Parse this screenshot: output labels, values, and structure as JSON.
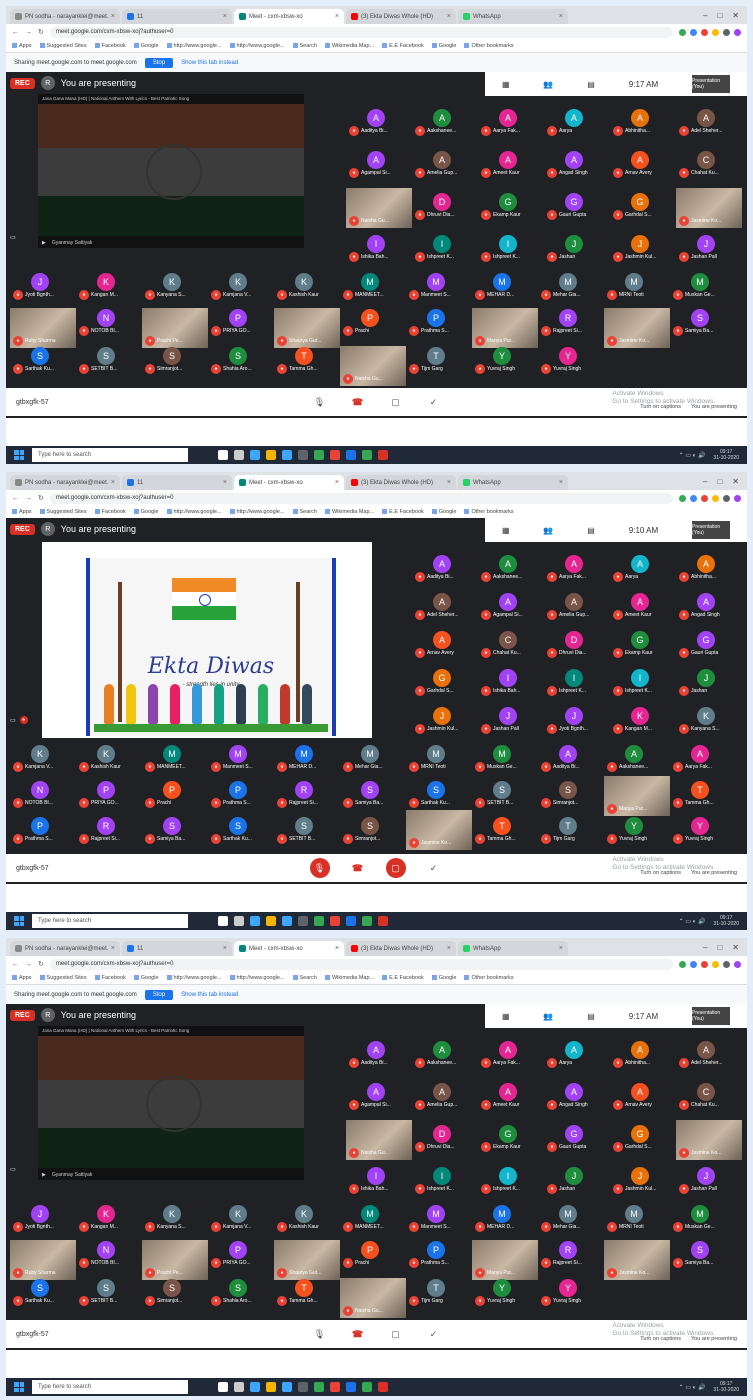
{
  "browser": {
    "tabs": [
      {
        "label": "PN sodha - narayanklei@meet.",
        "color": "#888888",
        "active": false
      },
      {
        "label": "11",
        "color": "#1a73e8",
        "active": false
      },
      {
        "label": "Meet - cxm-xbsw-xo",
        "color": "#00897b",
        "active": true
      },
      {
        "label": "(3) Ekta Diwas Whole (HD)",
        "color": "#ff0000",
        "active": false
      },
      {
        "label": "WhatsApp",
        "color": "#25d366",
        "active": false
      }
    ],
    "url": "meet.google.com/cxm-xbsw-xoj?authuser=0",
    "bookmarks": [
      "Apps",
      "Suggested Sites",
      "Facebook",
      "Google",
      "http://www.google...",
      "http://www.google...",
      "Search",
      "Wikimedia Map...",
      "E.E Facebook",
      "Google",
      "Other bookmarks"
    ],
    "infobar_text": "Sharing meet.google.com to meet.google.com",
    "infobar_button": "Stop",
    "infobar_link": "Show this tab instead"
  },
  "meeting": {
    "rec": "REC",
    "presenting_initial": "R",
    "presenting_label": "You are presenting",
    "panel_time_1": "9:17 AM",
    "panel_time_2": "9:10 AM",
    "panel_pres": "Presentation (You)",
    "meeting_code": "gtbxgfk-57",
    "video_title": "Jana Gana Mana (HD) | National Anthem With Lyrics - Best Patriotic Song",
    "video_channel": "Gyanmay Sattiyak",
    "slide_title": "Ekta Diwas",
    "slide_subtitle": "- strength lies in unity",
    "bottom": {
      "captions": "Turn on captions",
      "stop_presenting": "You are presenting",
      "activate_1": "Activate Windows",
      "activate_2": "Go to Settings to activate Windows."
    }
  },
  "participants_a": [
    {
      "i": "A",
      "n": "Aaditya Bi...",
      "c": "#a142f4"
    },
    {
      "i": "A",
      "n": "Aakshanee...",
      "c": "#1e8e3e"
    },
    {
      "i": "A",
      "n": "Aarya Fak...",
      "c": "#e52592"
    },
    {
      "i": "A",
      "n": "Aarya",
      "c": "#12b5cb"
    },
    {
      "i": "A",
      "n": "Abhinitha...",
      "c": "#e8710a"
    },
    {
      "i": "A",
      "n": "Adel Sheher...",
      "c": "#795548"
    },
    {
      "i": "A",
      "n": "Agampal Si...",
      "c": "#a142f4"
    },
    {
      "i": "A",
      "n": "Amelia Gup...",
      "c": "#795548"
    },
    {
      "i": "A",
      "n": "Ameet Kaur",
      "c": "#e52592"
    },
    {
      "i": "A",
      "n": "Angad Singh",
      "c": "#a142f4"
    },
    {
      "i": "A",
      "n": "Arnav Avery",
      "c": "#f4511e"
    },
    {
      "i": "C",
      "n": "Chahat Ku...",
      "c": "#795548"
    },
    {
      "i": "D",
      "n": "Dhruvi Dia...",
      "c": "#e52592"
    },
    {
      "i": "G",
      "n": "Ekamp Kaur",
      "c": "#1e8e3e"
    },
    {
      "i": "G",
      "n": "Gauri Gupta",
      "c": "#a142f4"
    },
    {
      "i": "G",
      "n": "Garhdal S...",
      "c": "#e8710a"
    },
    {
      "i": "I",
      "n": "Ishika Bah...",
      "c": "#a142f4"
    },
    {
      "i": "I",
      "n": "Ishpreet K...",
      "c": "#00897b"
    },
    {
      "i": "I",
      "n": "Ishpreet K...",
      "c": "#12b5cb"
    },
    {
      "i": "J",
      "n": "Jashan",
      "c": "#1e8e3e"
    },
    {
      "i": "J",
      "n": "Jashmin Kul...",
      "c": "#e8710a"
    },
    {
      "i": "J",
      "n": "Jashan Pall",
      "c": "#a142f4"
    },
    {
      "i": "J",
      "n": "Jyoti Bgnth...",
      "c": "#a142f4"
    },
    {
      "i": "K",
      "n": "Kangan M...",
      "c": "#e52592"
    },
    {
      "i": "K",
      "n": "Kanyana S...",
      "c": "#607d8b"
    },
    {
      "i": "K",
      "n": "Kamjana V...",
      "c": "#607d8b"
    },
    {
      "i": "K",
      "n": "Kashish Kaur",
      "c": "#607d8b"
    },
    {
      "i": "M",
      "n": "MANMEET...",
      "c": "#00897b"
    },
    {
      "i": "M",
      "n": "Manmeet S...",
      "c": "#a142f4"
    },
    {
      "i": "M",
      "n": "MEHAR D...",
      "c": "#1a73e8"
    },
    {
      "i": "M",
      "n": "Mehar Gia...",
      "c": "#607d8b"
    },
    {
      "i": "M",
      "n": "MRNI Teoti",
      "c": "#607d8b"
    },
    {
      "i": "M",
      "n": "Muskan Ge...",
      "c": "#1e8e3e"
    }
  ],
  "participants_b": [
    {
      "i": "N",
      "n": "NOTOB BI...",
      "c": "#a142f4"
    },
    {
      "i": "P",
      "n": "PRIYA GO...",
      "c": "#a142f4"
    },
    {
      "i": "P",
      "n": "Prachi",
      "c": "#f4511e"
    },
    {
      "i": "P",
      "n": "Prathma S...",
      "c": "#1a73e8"
    },
    {
      "i": "R",
      "n": "Rajpreet Si...",
      "c": "#a142f4"
    },
    {
      "i": "S",
      "n": "Samiya Ba...",
      "c": "#a142f4"
    },
    {
      "i": "S",
      "n": "Sarthak Ku...",
      "c": "#1a73e8"
    },
    {
      "i": "S",
      "n": "SETBIT B...",
      "c": "#607d8b"
    },
    {
      "i": "S",
      "n": "Simranjot...",
      "c": "#795548"
    },
    {
      "i": "S",
      "n": "Shahia Aro...",
      "c": "#1e8e3e"
    },
    {
      "i": "T",
      "n": "Tamma Gh...",
      "c": "#f4511e"
    },
    {
      "i": "T",
      "n": "Tijm Garg",
      "c": "#607d8b"
    },
    {
      "i": "Y",
      "n": "Yuvraj Singh",
      "c": "#1e8e3e"
    },
    {
      "i": "Y",
      "n": "Yuvraj Singh",
      "c": "#e52592"
    }
  ],
  "video_tiles": [
    {
      "n": "Naisha Gu..."
    },
    {
      "n": "Ruby Sharma"
    },
    {
      "n": "Prachi Pe..."
    },
    {
      "n": "Shaurya Gut..."
    },
    {
      "n": "Manya Pur..."
    },
    {
      "n": "Jasmine Ko..."
    }
  ],
  "taskbar": {
    "search_placeholder": "Type here to search",
    "time": "09:17",
    "date": "31-10-2020"
  }
}
